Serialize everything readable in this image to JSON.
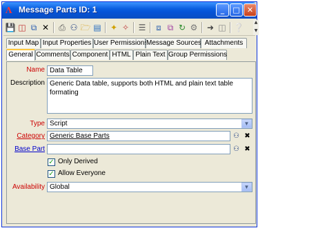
{
  "window": {
    "title": "Message Parts ID: 1",
    "logo": "Λ"
  },
  "title_buttons": {
    "minimize": "_",
    "maximize": "□",
    "close": "✕"
  },
  "tabs_row1": [
    "Input Map",
    "Input Properties",
    "User Permissions",
    "Message Sources",
    "Attachments"
  ],
  "tabs_row2": [
    "General",
    "Comments",
    "Component",
    "HTML",
    "Plain Text",
    "Group Permissions"
  ],
  "form": {
    "name_label": "Name",
    "name_value": "Data Table",
    "description_label": "Description",
    "description_value": "Generic Data table, supports both HTML and plain text table formating",
    "type_label": "Type",
    "type_value": "Script",
    "category_label": "Category",
    "category_value": "Generic Base Parts",
    "base_part_label": "Base Part",
    "base_part_value": "",
    "only_derived_label": "Only Derived",
    "allow_everyone_label": "Allow Everyone",
    "availability_label": "Availability",
    "availability_value": "Global"
  },
  "icons": {
    "browse": "⚇",
    "clear": "✖",
    "dropdown": "▼",
    "check": "✓"
  },
  "colors": {
    "required_label": "#cc0000",
    "link_label": "#0000cc",
    "titlebar": "#0a5fe0"
  }
}
